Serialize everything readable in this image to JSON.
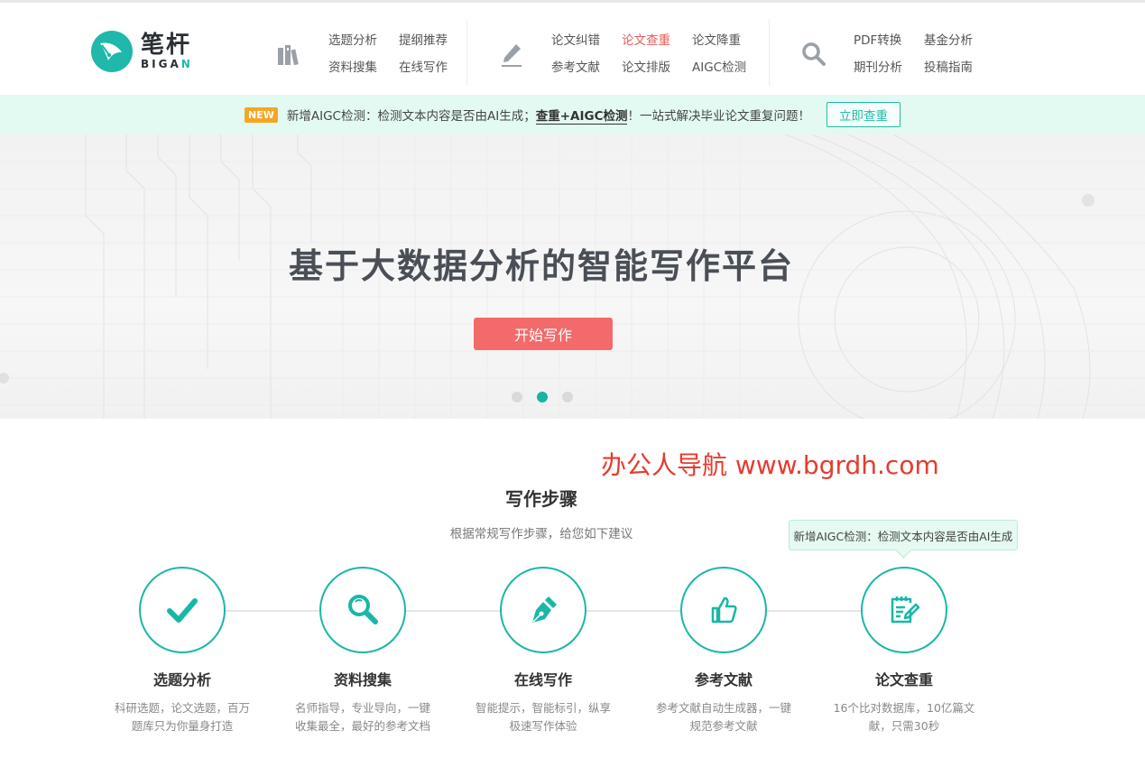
{
  "logo": {
    "cn": "笔杆",
    "en_main": "BIGA",
    "en_accent": "N"
  },
  "nav": {
    "group1": [
      "选题分析",
      "提纲推荐",
      "资料搜集",
      "在线写作"
    ],
    "group2": [
      "论文纠错",
      "论文查重",
      "论文降重",
      "参考文献",
      "论文排版",
      "AIGC检测"
    ],
    "group3": [
      "PDF转换",
      "基金分析",
      "期刊分析",
      "投稿指南"
    ],
    "active": "论文查重"
  },
  "notice": {
    "badge": "NEW",
    "text1": "新增AIGC检测：检测文本内容是否由AI生成；",
    "strong": "查重+AIGC检测",
    "text2": "！一站式解决毕业论文重复问题！",
    "button": "立即查重"
  },
  "banner": {
    "title": "基于大数据分析的智能写作平台",
    "button": "开始写作",
    "slides": 3,
    "active_slide": 2
  },
  "watermark": "办公人导航  www.bgrdh.com",
  "section": {
    "title": "写作步骤",
    "subtitle": "根据常规写作步骤，给您如下建议"
  },
  "tooltip": "新增AIGC检测：检测文本内容是否由AI生成",
  "steps": [
    {
      "icon": "checkmark-icon",
      "title": "选题分析",
      "desc": "科研选题，论文选题，百万题库只为你量身打造"
    },
    {
      "icon": "magnifier-icon",
      "title": "资料搜集",
      "desc": "名师指导，专业导向，一键收集最全，最好的参考文档"
    },
    {
      "icon": "fountain-pen-icon",
      "title": "在线写作",
      "desc": "智能提示，智能标引，纵享极速写作体验"
    },
    {
      "icon": "thumbs-up-icon",
      "title": "参考文献",
      "desc": "参考文献自动生成器，一键规范参考文献"
    },
    {
      "icon": "edit-document-icon",
      "title": "论文查重",
      "desc": "16个比对数据库，10亿篇文献，只需30秒"
    }
  ],
  "colors": {
    "brand": "#19b7a6",
    "accent_red": "#f26a6a",
    "active_nav": "#e85a55",
    "badge": "#f5a623"
  }
}
